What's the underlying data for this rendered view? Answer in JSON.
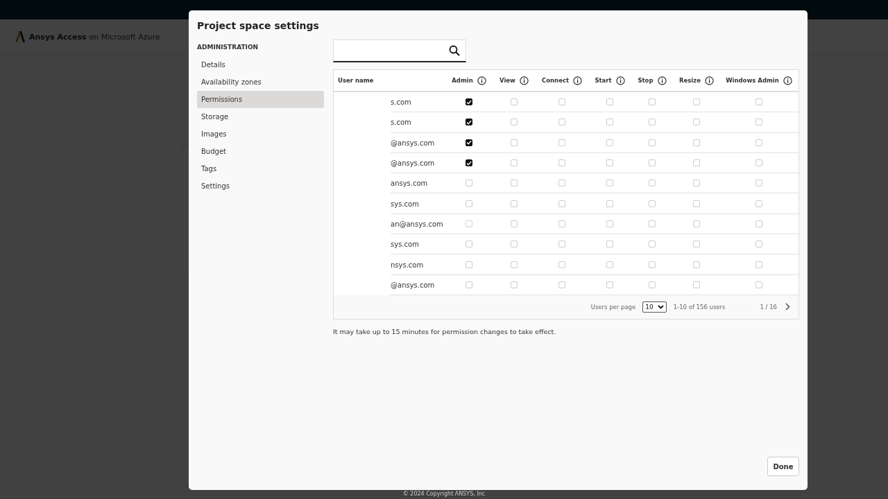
{
  "app_header": {
    "logo_bold": "Ansys Access",
    "logo_rest": "on Microsoft Azure"
  },
  "footer": {
    "copyright": "© 2024 Copyright ANSYS, Inc"
  },
  "dialog": {
    "title": "Project space settings",
    "sidebar": {
      "heading": "ADMINISTRATION",
      "items": [
        {
          "label": "Details",
          "selected": false
        },
        {
          "label": "Availability zones",
          "selected": false
        },
        {
          "label": "Permissions",
          "selected": true
        },
        {
          "label": "Storage",
          "selected": false
        },
        {
          "label": "Images",
          "selected": false
        },
        {
          "label": "Budget",
          "selected": false
        },
        {
          "label": "Tags",
          "selected": false
        },
        {
          "label": "Settings",
          "selected": false
        }
      ]
    },
    "table": {
      "columns": [
        "User name",
        "Admin",
        "View",
        "Connect",
        "Start",
        "Stop",
        "Resize",
        "Windows Admin"
      ],
      "rows": [
        {
          "user": "s.com",
          "permissions": [
            true,
            false,
            false,
            false,
            false,
            false,
            false
          ]
        },
        {
          "user": "s.com",
          "permissions": [
            true,
            false,
            false,
            false,
            false,
            false,
            false
          ]
        },
        {
          "user": "@ansys.com",
          "permissions": [
            true,
            false,
            false,
            false,
            false,
            false,
            false
          ]
        },
        {
          "user": "@ansys.com",
          "permissions": [
            true,
            false,
            false,
            false,
            false,
            false,
            false
          ]
        },
        {
          "user": "ansys.com",
          "permissions": [
            false,
            false,
            false,
            false,
            false,
            false,
            false
          ]
        },
        {
          "user": "sys.com",
          "permissions": [
            false,
            false,
            false,
            false,
            false,
            false,
            false
          ]
        },
        {
          "user": "an@ansys.com",
          "permissions": [
            false,
            false,
            false,
            false,
            false,
            false,
            false
          ]
        },
        {
          "user": "sys.com",
          "permissions": [
            false,
            false,
            false,
            false,
            false,
            false,
            false
          ]
        },
        {
          "user": "nsys.com",
          "permissions": [
            false,
            false,
            false,
            false,
            false,
            false,
            false
          ]
        },
        {
          "user": "@ansys.com",
          "permissions": [
            false,
            false,
            false,
            false,
            false,
            false,
            false
          ]
        }
      ]
    },
    "pagination": {
      "per_page_label": "Users per page",
      "per_page": "10",
      "range": "1-10 of 156 users",
      "page": "1 / 16"
    },
    "note": "It may take up to 15 minutes for permission changes to take effect.",
    "done_button": "Done"
  }
}
